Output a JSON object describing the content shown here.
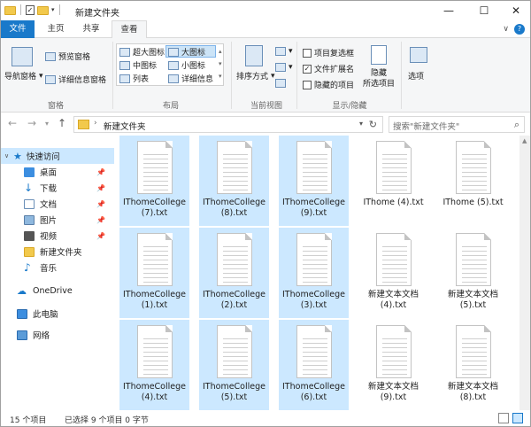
{
  "window": {
    "title": "新建文件夹",
    "controls": {
      "minimize": "—",
      "maximize": "☐",
      "close": "✕"
    }
  },
  "ribbon": {
    "tabs": [
      "文件",
      "主页",
      "共享",
      "查看"
    ],
    "active_tab": "查看",
    "groups": {
      "panes": {
        "label": "窗格",
        "nav_pane": "导航窗格",
        "preview": "预览窗格",
        "details": "详细信息窗格"
      },
      "layout": {
        "label": "布局",
        "items": [
          "超大图标",
          "大图标",
          "中图标",
          "小图标",
          "列表",
          "详细信息"
        ],
        "selected": "大图标"
      },
      "current_view": {
        "label": "当前视图",
        "sort": "排序方式"
      },
      "show_hide": {
        "label": "显示/隐藏",
        "checkboxes": [
          {
            "label": "项目复选框",
            "checked": false
          },
          {
            "label": "文件扩展名",
            "checked": true
          },
          {
            "label": "隐藏的项目",
            "checked": false
          }
        ],
        "hide_selected": [
          "隐藏",
          "所选项目"
        ]
      },
      "options": {
        "label": "选项"
      }
    }
  },
  "address_bar": {
    "path": "新建文件夹",
    "search_placeholder": "搜索\"新建文件夹\""
  },
  "nav_pane": {
    "items": [
      {
        "label": "快速访问",
        "icon": "star-icon",
        "selected": true,
        "pinned": false
      },
      {
        "label": "桌面",
        "icon": "desktop-icon",
        "selected": false,
        "pinned": true
      },
      {
        "label": "下载",
        "icon": "download-icon",
        "selected": false,
        "pinned": true
      },
      {
        "label": "文档",
        "icon": "document-icon",
        "selected": false,
        "pinned": true
      },
      {
        "label": "图片",
        "icon": "picture-icon",
        "selected": false,
        "pinned": true
      },
      {
        "label": "视频",
        "icon": "video-icon",
        "selected": false,
        "pinned": true
      },
      {
        "label": "新建文件夹",
        "icon": "folder-icon",
        "selected": false,
        "pinned": false
      },
      {
        "label": "音乐",
        "icon": "music-icon",
        "selected": false,
        "pinned": false
      },
      {
        "label": "OneDrive",
        "icon": "cloud-icon",
        "selected": false,
        "pinned": false
      },
      {
        "label": "此电脑",
        "icon": "computer-icon",
        "selected": false,
        "pinned": false
      },
      {
        "label": "网络",
        "icon": "network-icon",
        "selected": false,
        "pinned": false
      }
    ]
  },
  "files": [
    {
      "name": "IThomeCollege (7).txt",
      "selected": true
    },
    {
      "name": "IThomeCollege (8).txt",
      "selected": true
    },
    {
      "name": "IThomeCollege (9).txt",
      "selected": true
    },
    {
      "name": "IThome (4).txt",
      "selected": false
    },
    {
      "name": "IThome (5).txt",
      "selected": false
    },
    {
      "name": "IThomeCollege (1).txt",
      "selected": true
    },
    {
      "name": "IThomeCollege (2).txt",
      "selected": true
    },
    {
      "name": "IThomeCollege (3).txt",
      "selected": true
    },
    {
      "name": "新建文本文档 (4).txt",
      "selected": false
    },
    {
      "name": "新建文本文档 (5).txt",
      "selected": false
    },
    {
      "name": "IThomeCollege (4).txt",
      "selected": true
    },
    {
      "name": "IThomeCollege (5).txt",
      "selected": true
    },
    {
      "name": "IThomeCollege (6).txt",
      "selected": true
    },
    {
      "name": "新建文本文档 (9).txt",
      "selected": false
    },
    {
      "name": "新建文本文档 (8).txt",
      "selected": false
    }
  ],
  "status": {
    "count": "15 个项目",
    "selection": "已选择 9 个项目 0 字节"
  },
  "colors": {
    "accent": "#1979ca",
    "selection": "#cce8ff",
    "folder": "#f2c94c"
  }
}
